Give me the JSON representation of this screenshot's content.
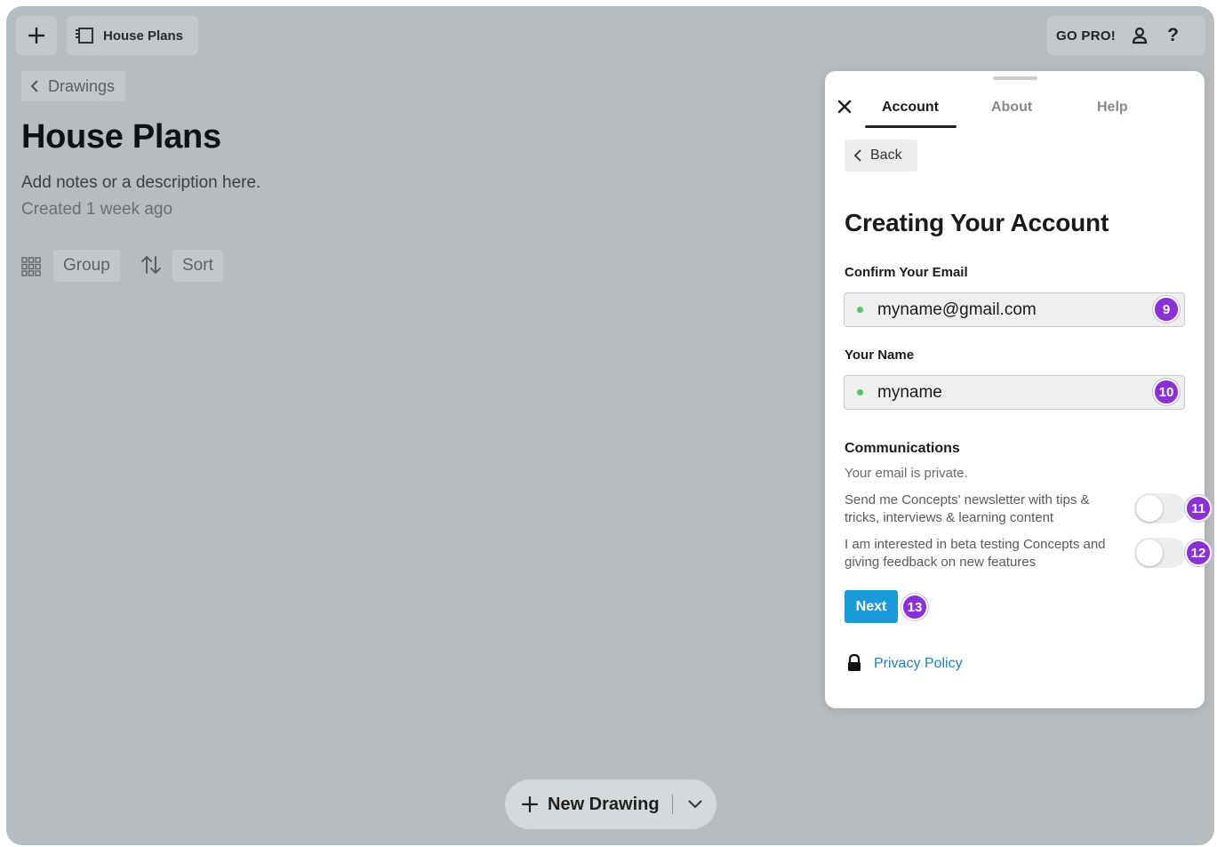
{
  "toolbar": {
    "document_name": "House Plans",
    "go_pro_label": "GO PRO!",
    "help_label": "?"
  },
  "page": {
    "breadcrumb": "Drawings",
    "title": "House Plans",
    "description": "Add notes or a description here.",
    "created": "Created 1 week ago",
    "group_label": "Group",
    "sort_label": "Sort",
    "new_drawing_label": "New Drawing"
  },
  "panel": {
    "tabs": [
      {
        "label": "Account",
        "active": true
      },
      {
        "label": "About",
        "active": false
      },
      {
        "label": "Help",
        "active": false
      }
    ],
    "back_label": "Back",
    "title": "Creating Your Account",
    "email_label": "Confirm Your Email",
    "email_value": "myname@gmail.com",
    "email_badge": "9",
    "name_label": "Your Name",
    "name_value": "myname",
    "name_badge": "10",
    "communications_title": "Communications",
    "communications_subtitle": "Your email is private.",
    "newsletter_text": "Send me Concepts' newsletter with tips & tricks, interviews & learning content",
    "newsletter_enabled": false,
    "newsletter_badge": "11",
    "beta_text": "I am interested in beta testing Concepts and giving feedback on new features",
    "beta_enabled": false,
    "beta_badge": "12",
    "next_label": "Next",
    "next_badge": "13",
    "privacy_label": "Privacy Policy"
  },
  "colors": {
    "background": "#b6bcbf",
    "accent_blue": "#1a9ad8",
    "badge_purple": "#8b2fd6",
    "link": "#1a7fc4",
    "field_dot": "#5cc06a"
  },
  "icons": [
    "plus-icon",
    "document-icon",
    "user-icon",
    "chevron-left-icon",
    "grid-icon",
    "sort-icon",
    "close-icon",
    "lock-icon",
    "chevron-down-icon"
  ]
}
